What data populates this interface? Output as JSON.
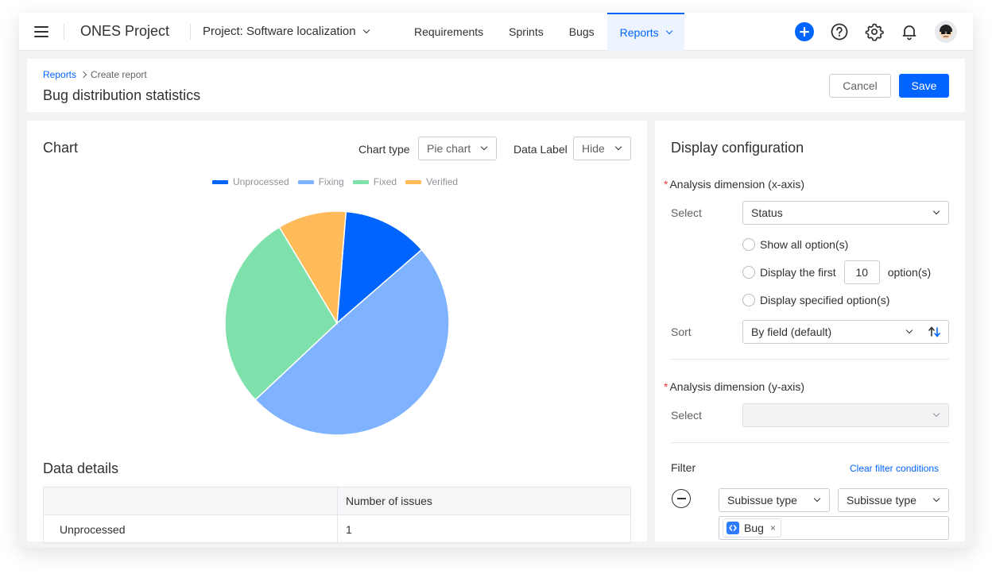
{
  "nav": {
    "brand": "ONES Project",
    "project": "Project: Software localization",
    "tabs": [
      {
        "label": "Requirements"
      },
      {
        "label": "Sprints"
      },
      {
        "label": "Bugs"
      },
      {
        "label": "Reports"
      }
    ],
    "active_tab": "Reports",
    "icons": [
      "plus-circle-icon",
      "help-icon",
      "gear-icon",
      "bell-icon",
      "avatar"
    ]
  },
  "header": {
    "breadcrumb": {
      "parent": "Reports",
      "current": "Create report"
    },
    "title": "Bug distribution statistics",
    "cancel_label": "Cancel",
    "save_label": "Save"
  },
  "chart_panel": {
    "title": "Chart",
    "chart_type_label": "Chart type",
    "chart_type_value": "Pie chart",
    "data_label_label": "Data Label",
    "data_label_value": "Hide"
  },
  "chart_data": {
    "type": "pie",
    "categories": [
      "Unprocessed",
      "Fixing",
      "Fixed",
      "Verified"
    ],
    "values": [
      1,
      4,
      2.3,
      0.8
    ],
    "colors": [
      "#0064ff",
      "#7fb2ff",
      "#7ee0aa",
      "#ffba5a"
    ],
    "legend": "top-center",
    "data_labels": "hidden"
  },
  "details": {
    "title": "Data details",
    "columns": [
      "",
      "Number of issues"
    ],
    "rows": [
      {
        "label": "Unprocessed",
        "value": "1"
      }
    ]
  },
  "config": {
    "title": "Display configuration",
    "x_axis": {
      "label": "Analysis dimension (x-axis)",
      "select_label": "Select",
      "select_value": "Status",
      "options": {
        "show_all": "Show all option(s)",
        "first_prefix": "Display the first",
        "first_count": "10",
        "first_suffix": "option(s)",
        "specified": "Display specified option(s)"
      },
      "sort_label": "Sort",
      "sort_value": "By field (default)"
    },
    "y_axis": {
      "label": "Analysis dimension (y-axis)",
      "select_label": "Select",
      "select_value": ""
    },
    "filter": {
      "label": "Filter",
      "clear_label": "Clear filter conditions",
      "field_a": "Subissue type",
      "field_b": "Subissue type",
      "tags": [
        {
          "label": "Bug"
        }
      ]
    }
  }
}
